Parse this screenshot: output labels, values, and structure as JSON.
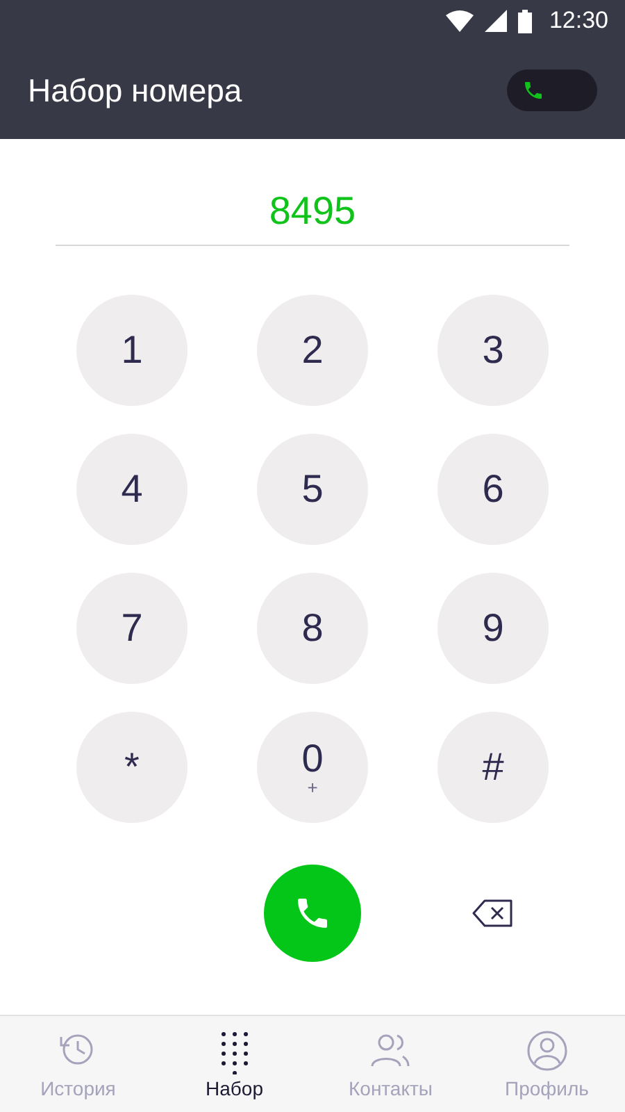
{
  "status_bar": {
    "time": "12:30"
  },
  "header": {
    "title": "Набор номера",
    "toggle": {
      "on": false
    }
  },
  "number": {
    "value": "8495"
  },
  "keys": [
    {
      "label": "1"
    },
    {
      "label": "2"
    },
    {
      "label": "3"
    },
    {
      "label": "4"
    },
    {
      "label": "5"
    },
    {
      "label": "6"
    },
    {
      "label": "7"
    },
    {
      "label": "8"
    },
    {
      "label": "9"
    },
    {
      "label": "*"
    },
    {
      "label": "0",
      "sub": "+"
    },
    {
      "label": "#"
    }
  ],
  "tabs": [
    {
      "kind": "history",
      "label": "История",
      "selected": false
    },
    {
      "kind": "dialpad",
      "label": "Набор",
      "selected": true
    },
    {
      "kind": "contacts",
      "label": "Контакты",
      "selected": false
    },
    {
      "kind": "profile",
      "label": "Профиль",
      "selected": false
    }
  ]
}
